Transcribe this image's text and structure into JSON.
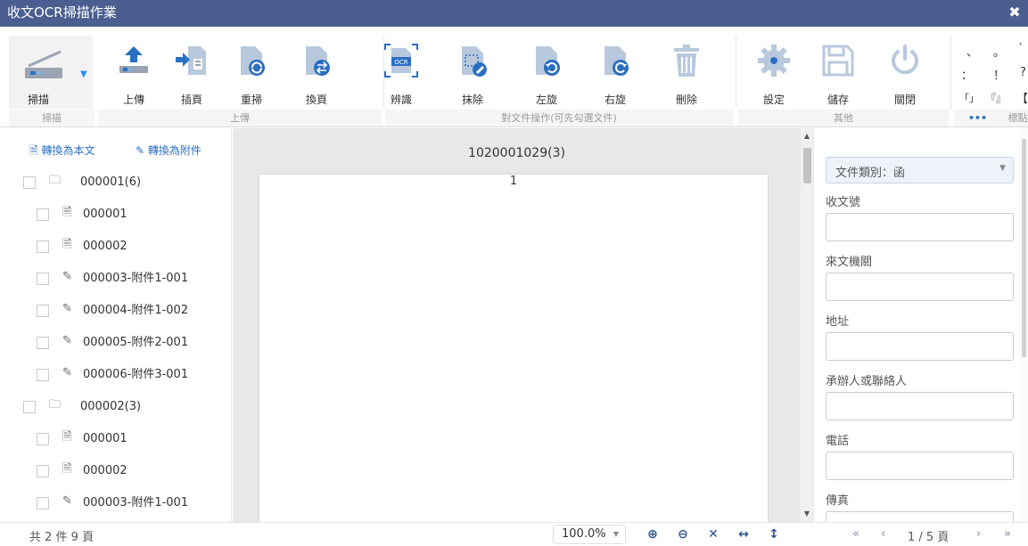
{
  "window": {
    "title": "收文OCR掃描作業",
    "close_glyph": "✖"
  },
  "ribbon": {
    "scan_label": "掃描",
    "upload_label": "上傳",
    "insert_label": "插頁",
    "rescan_label": "重掃",
    "swap_label": "換頁",
    "recognize_label": "辨識",
    "erase_label": "抹除",
    "rotate_left_label": "左旋",
    "rotate_right_label": "右旋",
    "delete_label": "刪除",
    "settings_label": "設定",
    "save_label": "儲存",
    "close_label": "關閉",
    "groups": {
      "scan": "掃描",
      "upload": "上傳",
      "doc_ops": "對文件操作(可先勾選文件)",
      "other": "其他",
      "more": "•••",
      "punct": "標點"
    },
    "punct_chars": [
      "、",
      "。",
      "`",
      "：",
      "！",
      "?",
      "「」",
      "『』",
      "【"
    ],
    "accent_color": "#2b6fc2"
  },
  "left_panel": {
    "convert_text": "轉換為本文",
    "convert_attach": "轉換為附件",
    "tree": [
      {
        "type": "folder",
        "label": "000001(6)"
      },
      {
        "type": "doc",
        "label": "000001"
      },
      {
        "type": "doc",
        "label": "000002"
      },
      {
        "type": "attach",
        "label": "000003-附件1-001"
      },
      {
        "type": "attach",
        "label": "000004-附件1-002"
      },
      {
        "type": "attach",
        "label": "000005-附件2-001"
      },
      {
        "type": "attach",
        "label": "000006-附件3-001"
      },
      {
        "type": "folder",
        "label": "000002(3)"
      },
      {
        "type": "doc",
        "label": "000001"
      },
      {
        "type": "doc",
        "label": "000002"
      },
      {
        "type": "attach",
        "label": "000003-附件1-001"
      }
    ]
  },
  "viewer": {
    "doc_title": "1020001029(3)",
    "page_number": "1"
  },
  "form": {
    "category": "文件類別：函",
    "fields": [
      "收文號",
      "來文機關",
      "地址",
      "承辦人或聯絡人",
      "電話",
      "傳真"
    ]
  },
  "status": {
    "count_text": "共 2 件 9 頁",
    "zoom": "100.0%",
    "page_info": "1 / 5 頁",
    "first": "«",
    "prev": "‹",
    "next": "›",
    "last": "»"
  }
}
